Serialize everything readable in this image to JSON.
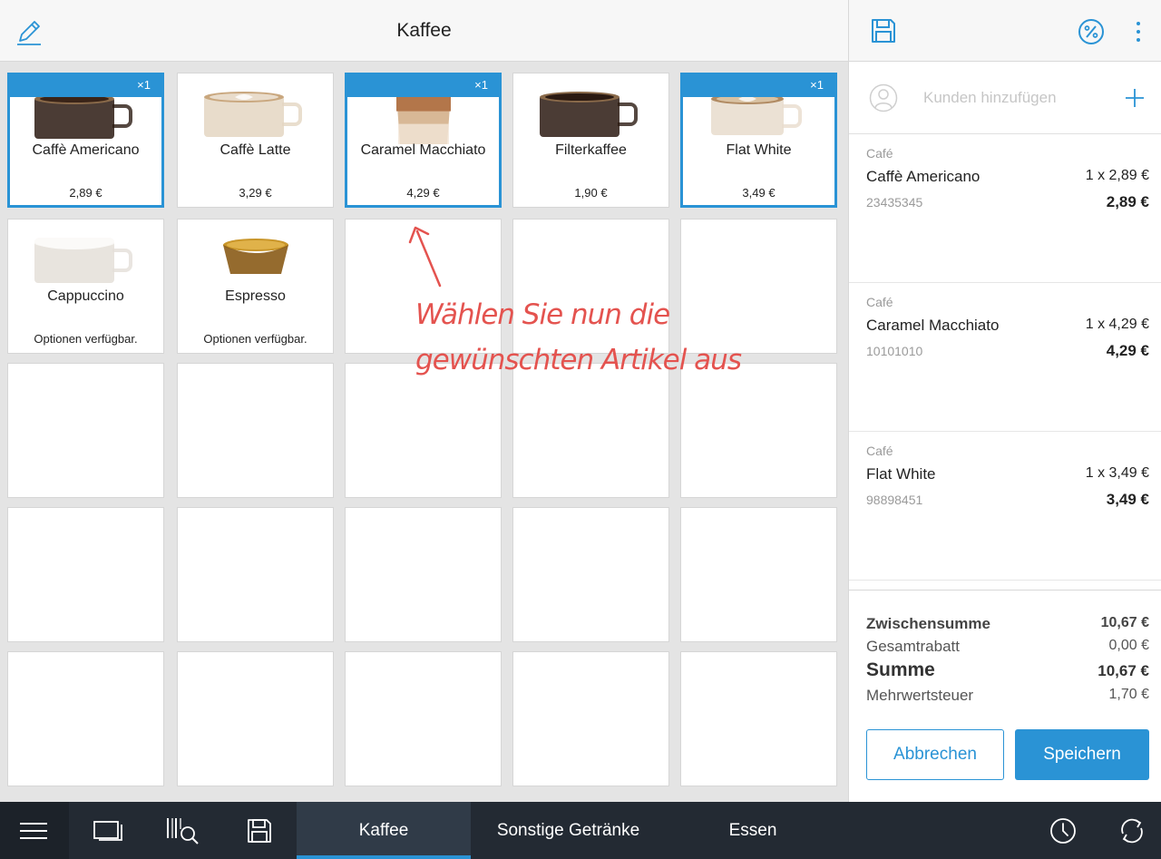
{
  "header": {
    "title": "Kaffee"
  },
  "colors": {
    "accent": "#2a93d5",
    "annotation": "#e4534f",
    "bottom_bar": "#232a33"
  },
  "products": [
    {
      "name": "Caffè Americano",
      "price": "2,89 €",
      "selected": true,
      "badge": "×1",
      "cup": "americano"
    },
    {
      "name": "Caffè Latte",
      "price": "3,29 €",
      "selected": false,
      "badge": "",
      "cup": "latte"
    },
    {
      "name": "Caramel Macchiato",
      "price": "4,29 €",
      "selected": true,
      "badge": "×1",
      "cup": "macchiato"
    },
    {
      "name": "Filterkaffee",
      "price": "1,90 €",
      "selected": false,
      "badge": "",
      "cup": "filter"
    },
    {
      "name": "Flat White",
      "price": "3,49 €",
      "selected": true,
      "badge": "×1",
      "cup": "flatwhite"
    },
    {
      "name": "Cappuccino",
      "price": "Optionen verfügbar.",
      "selected": false,
      "badge": "",
      "cup": "cappuccino"
    },
    {
      "name": "Espresso",
      "price": "Optionen verfügbar.",
      "selected": false,
      "badge": "",
      "cup": "espresso"
    }
  ],
  "annotation": {
    "line1": "Wählen Sie nun die",
    "line2": "gewünschten Artikel aus"
  },
  "customer": {
    "placeholder": "Kunden hinzufügen"
  },
  "order_items": [
    {
      "category": "Café",
      "name": "Caffè Americano",
      "qty": "1 x 2,89 €",
      "sku": "23435345",
      "total": "2,89 €"
    },
    {
      "category": "Café",
      "name": "Caramel Macchiato",
      "qty": "1 x 4,29 €",
      "sku": "10101010",
      "total": "4,29 €"
    },
    {
      "category": "Café",
      "name": "Flat White",
      "qty": "1 x 3,49 €",
      "sku": "98898451",
      "total": "3,49 €"
    }
  ],
  "totals": {
    "subtotal_label": "Zwischensumme",
    "subtotal": "10,67 €",
    "discount_label": "Gesamtrabatt",
    "discount": "0,00 €",
    "sum_label": "Summe",
    "sum": "10,67 €",
    "vat_label": "Mehrwertsteuer",
    "vat": "1,70 €"
  },
  "actions": {
    "cancel": "Abbrechen",
    "save": "Speichern"
  },
  "tabs": [
    {
      "label": "Kaffee",
      "active": true
    },
    {
      "label": "Sonstige Getränke",
      "active": false
    },
    {
      "label": "Essen",
      "active": false
    }
  ],
  "icons": [
    "pencil-icon",
    "floppy-disk-icon",
    "percent-icon",
    "more-vertical-icon",
    "user-icon",
    "plus-icon",
    "menu-icon",
    "screens-icon",
    "barcode-search-icon",
    "clock-icon",
    "sync-icon"
  ]
}
